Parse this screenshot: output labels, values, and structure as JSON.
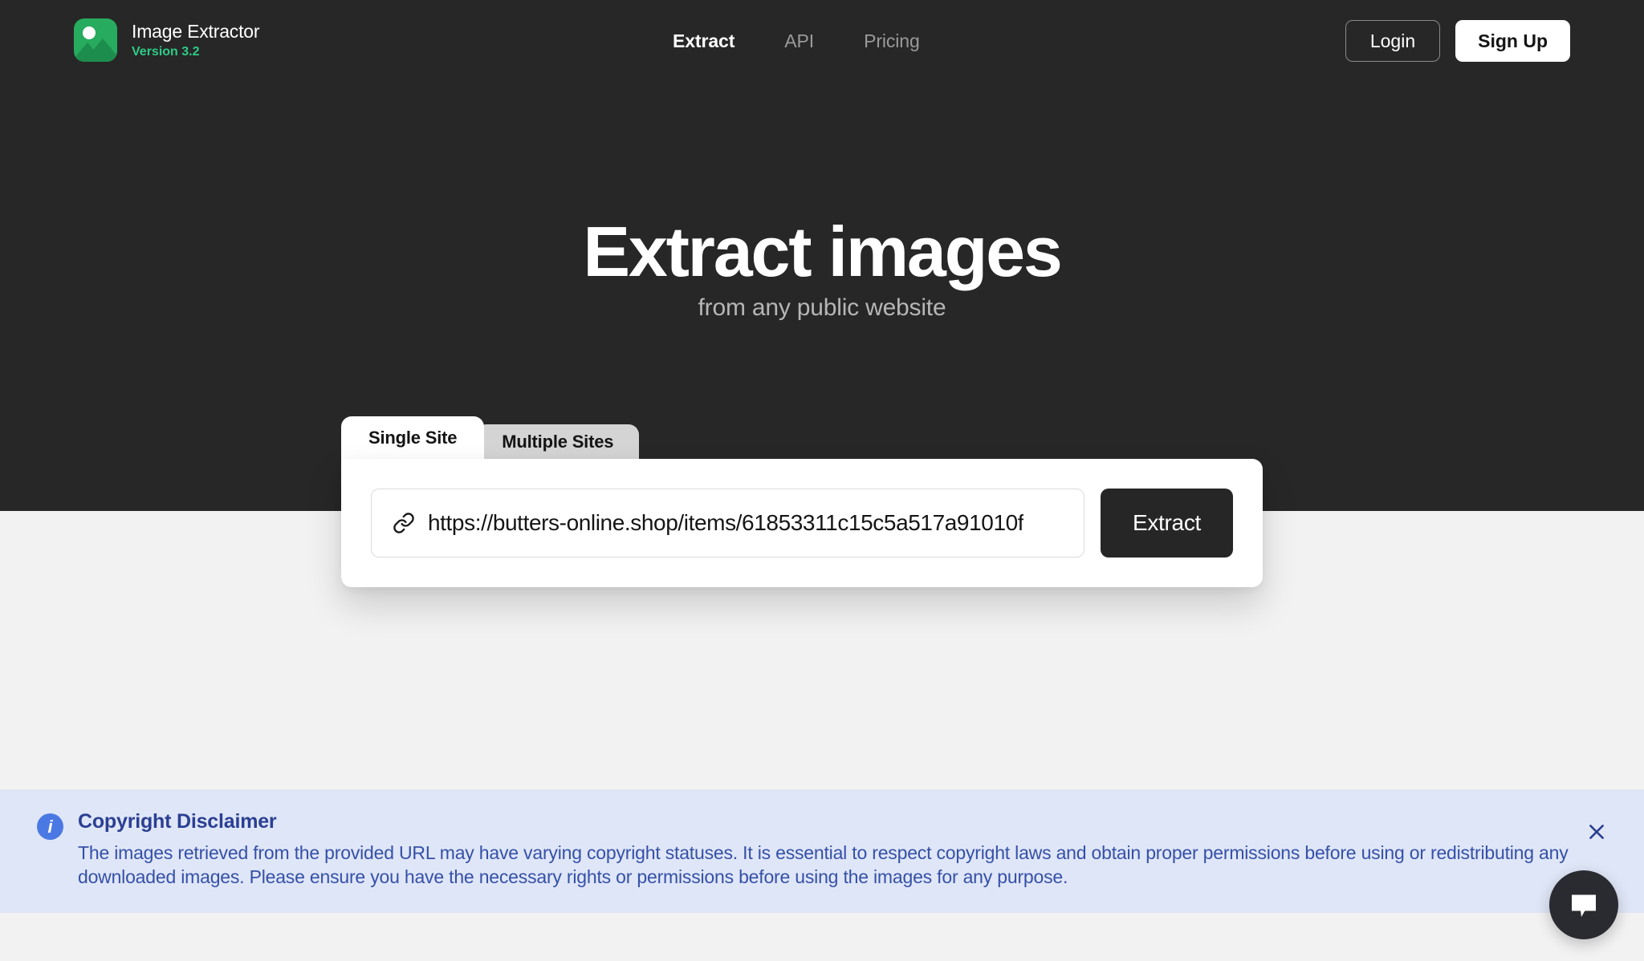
{
  "navbar": {
    "brand": {
      "name": "Image Extractor",
      "version": "Version 3.2",
      "logo_icon": "image-mountain-icon",
      "logo_color": "#27ab5f"
    },
    "links": [
      {
        "label": "Extract",
        "active": true
      },
      {
        "label": "API",
        "active": false
      },
      {
        "label": "Pricing",
        "active": false
      }
    ],
    "login_label": "Login",
    "signup_label": "Sign Up"
  },
  "hero": {
    "title": "Extract images",
    "subtitle": "from any public website",
    "background_color": "#272727"
  },
  "extract_panel": {
    "tabs": [
      {
        "label": "Single Site",
        "active": true
      },
      {
        "label": "Multiple Sites",
        "active": false
      }
    ],
    "url_input": {
      "value": "https://butters-online.shop/items/61853311c15c5a517a91010f",
      "placeholder": "https://",
      "icon": "link-icon"
    },
    "extract_button_label": "Extract"
  },
  "disclaimer": {
    "icon": "info-icon",
    "title": "Copyright Disclaimer",
    "text": "The images retrieved from the provided URL may have varying copyright statuses. It is essential to respect copyright laws and obtain proper permissions before using or redistributing any downloaded images. Please ensure you have the necessary rights or permissions before using the images for any purpose.",
    "close_icon": "close-icon",
    "background_color": "#dfe6f7",
    "accent_color": "#2b3f93"
  },
  "chat_widget": {
    "icon": "chat-bubble-icon",
    "color": "#2a2b30"
  }
}
